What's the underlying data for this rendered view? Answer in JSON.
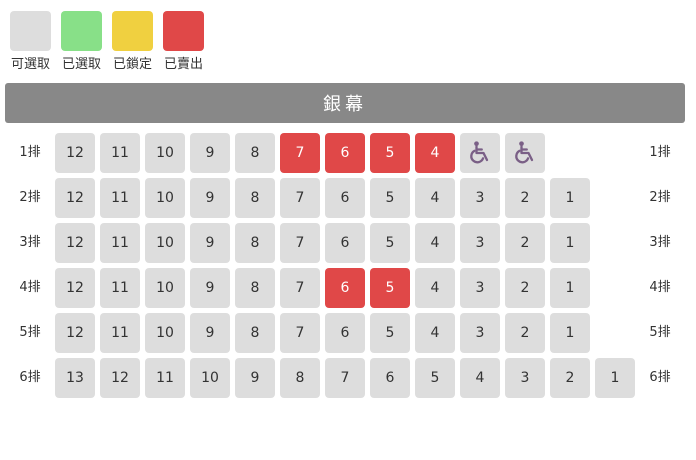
{
  "legend": [
    {
      "label": "可選取",
      "status": "available",
      "color": "#dddddd"
    },
    {
      "label": "已選取",
      "status": "selected",
      "color": "#88e088"
    },
    {
      "label": "已鎖定",
      "status": "locked",
      "color": "#f0d040"
    },
    {
      "label": "已賣出",
      "status": "sold",
      "color": "#e04848"
    }
  ],
  "screen_label": "銀幕",
  "colors": {
    "available": "#dddddd",
    "selected": "#88e088",
    "locked": "#f0d040",
    "sold": "#e04848",
    "screen": "#888888",
    "wheelchair_icon": "#7a5f86"
  },
  "rows": [
    {
      "label": "1排",
      "seats": [
        {
          "label": "12",
          "status": "available"
        },
        {
          "label": "11",
          "status": "available"
        },
        {
          "label": "10",
          "status": "available"
        },
        {
          "label": "9",
          "status": "available"
        },
        {
          "label": "8",
          "status": "available"
        },
        {
          "label": "7",
          "status": "sold"
        },
        {
          "label": "6",
          "status": "sold"
        },
        {
          "label": "5",
          "status": "sold"
        },
        {
          "label": "4",
          "status": "sold"
        },
        {
          "label": "",
          "status": "available",
          "icon": "wheelchair-icon"
        },
        {
          "label": "",
          "status": "available",
          "icon": "wheelchair-icon"
        }
      ]
    },
    {
      "label": "2排",
      "seats": [
        {
          "label": "12",
          "status": "available"
        },
        {
          "label": "11",
          "status": "available"
        },
        {
          "label": "10",
          "status": "available"
        },
        {
          "label": "9",
          "status": "available"
        },
        {
          "label": "8",
          "status": "available"
        },
        {
          "label": "7",
          "status": "available"
        },
        {
          "label": "6",
          "status": "available"
        },
        {
          "label": "5",
          "status": "available"
        },
        {
          "label": "4",
          "status": "available"
        },
        {
          "label": "3",
          "status": "available"
        },
        {
          "label": "2",
          "status": "available"
        },
        {
          "label": "1",
          "status": "available"
        }
      ]
    },
    {
      "label": "3排",
      "seats": [
        {
          "label": "12",
          "status": "available"
        },
        {
          "label": "11",
          "status": "available"
        },
        {
          "label": "10",
          "status": "available"
        },
        {
          "label": "9",
          "status": "available"
        },
        {
          "label": "8",
          "status": "available"
        },
        {
          "label": "7",
          "status": "available"
        },
        {
          "label": "6",
          "status": "available"
        },
        {
          "label": "5",
          "status": "available"
        },
        {
          "label": "4",
          "status": "available"
        },
        {
          "label": "3",
          "status": "available"
        },
        {
          "label": "2",
          "status": "available"
        },
        {
          "label": "1",
          "status": "available"
        }
      ]
    },
    {
      "label": "4排",
      "seats": [
        {
          "label": "12",
          "status": "available"
        },
        {
          "label": "11",
          "status": "available"
        },
        {
          "label": "10",
          "status": "available"
        },
        {
          "label": "9",
          "status": "available"
        },
        {
          "label": "8",
          "status": "available"
        },
        {
          "label": "7",
          "status": "available"
        },
        {
          "label": "6",
          "status": "sold"
        },
        {
          "label": "5",
          "status": "sold"
        },
        {
          "label": "4",
          "status": "available"
        },
        {
          "label": "3",
          "status": "available"
        },
        {
          "label": "2",
          "status": "available"
        },
        {
          "label": "1",
          "status": "available"
        }
      ]
    },
    {
      "label": "5排",
      "seats": [
        {
          "label": "12",
          "status": "available"
        },
        {
          "label": "11",
          "status": "available"
        },
        {
          "label": "10",
          "status": "available"
        },
        {
          "label": "9",
          "status": "available"
        },
        {
          "label": "8",
          "status": "available"
        },
        {
          "label": "7",
          "status": "available"
        },
        {
          "label": "6",
          "status": "available"
        },
        {
          "label": "5",
          "status": "available"
        },
        {
          "label": "4",
          "status": "available"
        },
        {
          "label": "3",
          "status": "available"
        },
        {
          "label": "2",
          "status": "available"
        },
        {
          "label": "1",
          "status": "available"
        }
      ]
    },
    {
      "label": "6排",
      "seats": [
        {
          "label": "13",
          "status": "available"
        },
        {
          "label": "12",
          "status": "available"
        },
        {
          "label": "11",
          "status": "available"
        },
        {
          "label": "10",
          "status": "available"
        },
        {
          "label": "9",
          "status": "available"
        },
        {
          "label": "8",
          "status": "available"
        },
        {
          "label": "7",
          "status": "available"
        },
        {
          "label": "6",
          "status": "available"
        },
        {
          "label": "5",
          "status": "available"
        },
        {
          "label": "4",
          "status": "available"
        },
        {
          "label": "3",
          "status": "available"
        },
        {
          "label": "2",
          "status": "available"
        },
        {
          "label": "1",
          "status": "available"
        }
      ]
    }
  ]
}
